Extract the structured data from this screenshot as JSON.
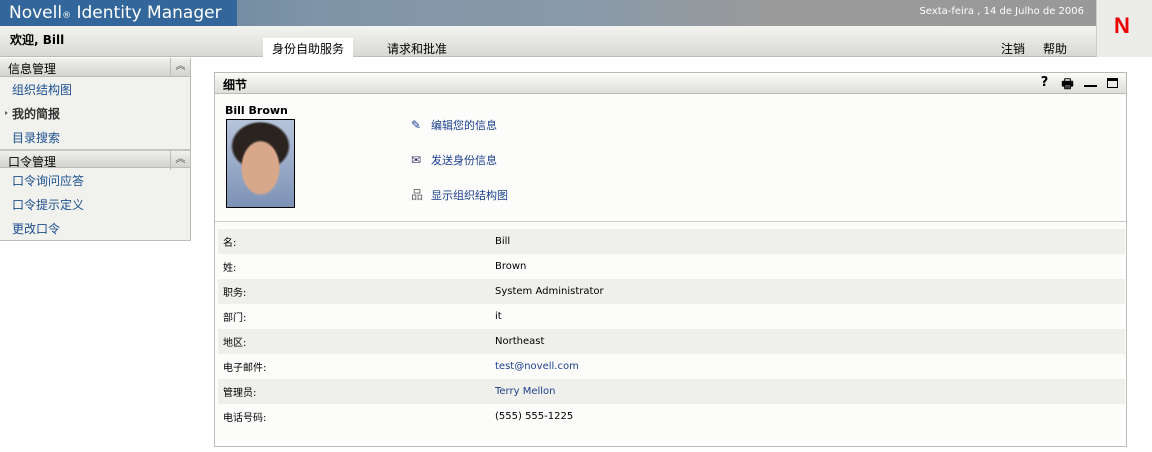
{
  "header": {
    "brand": "Novell",
    "brand_reg": "®",
    "product": "Identity Manager",
    "date": "Sexta-feira , 14 de Julho de 2006",
    "logo": "N",
    "welcome": "欢迎, Bill",
    "tabs": [
      {
        "label": "身份自助服务",
        "active": true
      },
      {
        "label": "请求和批准",
        "active": false
      }
    ],
    "logout": "注销",
    "help": "帮助"
  },
  "sidebar": {
    "sections": [
      {
        "title": "信息管理",
        "items": [
          "组织结构图",
          "我的简报",
          "目录搜索"
        ]
      },
      {
        "title": "口令管理",
        "items": [
          "口令询问应答",
          "口令提示定义",
          "更改口令"
        ]
      }
    ],
    "current": "我的简报",
    "collapse_icon": "double-chevron-up-icon"
  },
  "panel": {
    "title": "细节",
    "icons": [
      "help-icon",
      "print-icon",
      "minimize-icon",
      "maximize-icon"
    ],
    "help_glyph": "?",
    "person_name": "Bill Brown",
    "actions": [
      {
        "icon": "pencil-icon",
        "label": "编辑您的信息"
      },
      {
        "icon": "envelope-icon",
        "label": "发送身份信息"
      },
      {
        "icon": "org-chart-icon",
        "label": "显示组织结构图"
      }
    ],
    "fields": [
      {
        "label": "名:",
        "value": "Bill"
      },
      {
        "label": "姓:",
        "value": "Brown"
      },
      {
        "label": "职务:",
        "value": "System Administrator"
      },
      {
        "label": "部门:",
        "value": "it"
      },
      {
        "label": "地区:",
        "value": "Northeast"
      },
      {
        "label": "电子邮件:",
        "value": "test@novell.com",
        "link": true
      },
      {
        "label": "管理员:",
        "value": "Terry Mellon",
        "link": true
      },
      {
        "label": "电话号码:",
        "value": "(555) 555-1225"
      }
    ]
  }
}
